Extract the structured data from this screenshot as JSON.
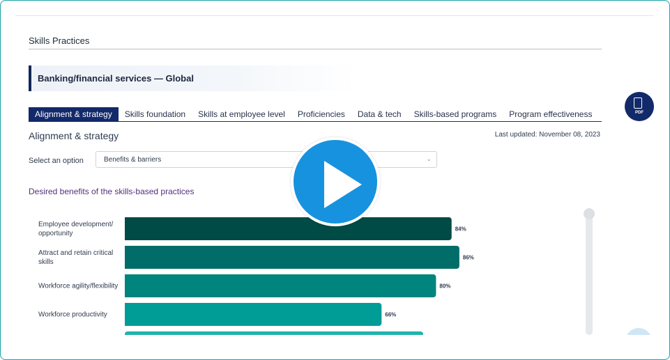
{
  "page": {
    "section_title": "Skills Practices",
    "banner": "Banking/financial services — Global",
    "tabs": [
      "Alignment & strategy",
      "Skills foundation",
      "Skills at employee level",
      "Proficiencies",
      "Data & tech",
      "Skills-based programs",
      "Program effectiveness"
    ],
    "active_tab": "Alignment & strategy",
    "subheading": "Alignment & strategy",
    "last_updated": "Last updated: November 08, 2023",
    "select_label": "Select an option",
    "select_value": "Benefits & barriers",
    "pdf_label": "PDF",
    "pdf_icon": "document-download-icon",
    "play_icon": "play-icon",
    "colors": {
      "accent": "#12296a",
      "play": "#1792de"
    }
  },
  "chart_data": {
    "type": "bar",
    "orientation": "horizontal",
    "title": "Desired benefits of the skills-based practices",
    "categories": [
      [
        "Employee development/",
        "opportunity"
      ],
      [
        "Attract and retain critical",
        "skills"
      ],
      [
        "Workforce agility/flexibility"
      ],
      [
        "Workforce productivity"
      ]
    ],
    "values": [
      84,
      86,
      80,
      66
    ],
    "value_labels": [
      "84%",
      "86%",
      "80%",
      "66%"
    ],
    "bar_colors": [
      "#004b45",
      "#006d68",
      "#00847e",
      "#009d96"
    ],
    "partial_next_bar": {
      "color": "#20b3ad"
    },
    "xlim": [
      0,
      100
    ]
  }
}
